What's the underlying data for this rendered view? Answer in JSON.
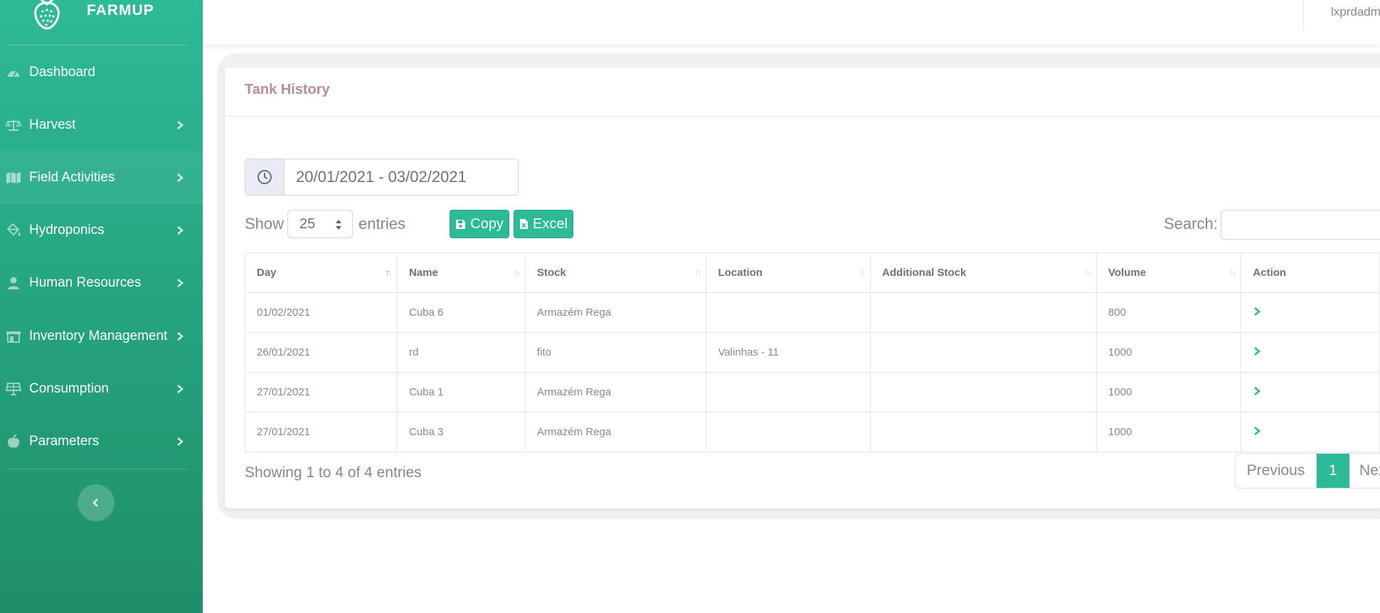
{
  "brand": {
    "name": "FARMUP",
    "logo_icon": "strawberry-icon"
  },
  "sidebar": {
    "items": [
      {
        "label": "Dashboard",
        "icon": "speedometer-icon"
      },
      {
        "label": "Harvest",
        "icon": "balance-scale-icon"
      },
      {
        "label": "Field Activities",
        "icon": "map-icon"
      },
      {
        "label": "Hydroponics",
        "icon": "paint-bucket-icon"
      },
      {
        "label": "Human Resources",
        "icon": "user-icon"
      },
      {
        "label": "Inventory Management",
        "icon": "store-icon"
      },
      {
        "label": "Consumption",
        "icon": "solar-panel-icon"
      },
      {
        "label": "Parameters",
        "icon": "apple-icon"
      }
    ],
    "toggle_icon": "chevron-left-icon"
  },
  "topbar": {
    "username": "lxprdadm"
  },
  "card": {
    "title": "Tank History"
  },
  "daterange": {
    "value": "20/01/2021 - 03/02/2021",
    "icon": "clock-icon"
  },
  "controls": {
    "show_label": "Show",
    "entries_value": "25",
    "entries_label": "entries",
    "copy_label": "Copy",
    "excel_label": "Excel",
    "search_label": "Search:"
  },
  "table": {
    "headers": [
      "Day",
      "Name",
      "Stock",
      "Location",
      "Additional Stock",
      "Volume",
      "Action"
    ],
    "rows": [
      [
        "01/02/2021",
        "Cuba 6",
        "Armazém Rega",
        "",
        "",
        "800"
      ],
      [
        "26/01/2021",
        "rd",
        "fito",
        "Valinhas - 11",
        "",
        "1000"
      ],
      [
        "27/01/2021",
        "Cuba 1",
        "Armazém Rega",
        "",
        "",
        "1000"
      ],
      [
        "27/01/2021",
        "Cuba 3",
        "Armazém Rega",
        "",
        "",
        "1000"
      ]
    ]
  },
  "footer": {
    "info": "Showing 1 to 4 of 4 entries",
    "previous_label": "Previous",
    "current_page": "1",
    "next_label": "Next"
  },
  "colors": {
    "accent": "#2dba96",
    "title": "#b78e95"
  }
}
